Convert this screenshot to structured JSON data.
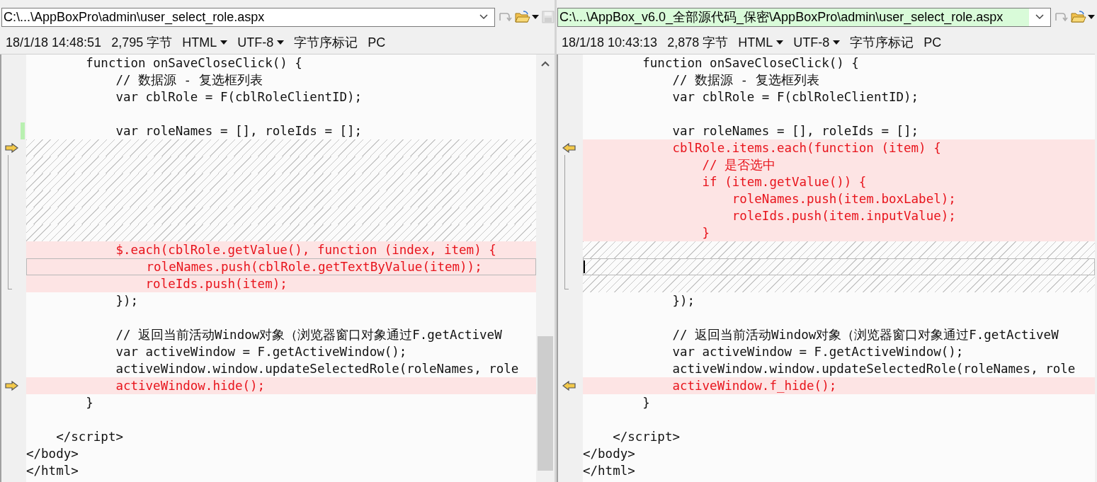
{
  "panes": [
    {
      "path": "C:\\...\\AppBoxPro\\admin\\user_select_role.aspx",
      "path_highlighted": false,
      "save_enabled": false,
      "info": {
        "timestamp": "18/1/18 14:48:51",
        "size": "2,795 字节",
        "format": "HTML",
        "encoding": "UTF-8",
        "bom": "字节序标记",
        "line_ending": "PC"
      },
      "lines": [
        {
          "kind": "code",
          "text": "        function onSaveCloseClick() {"
        },
        {
          "kind": "code",
          "text": "            // 数据源 - 复选框列表"
        },
        {
          "kind": "code",
          "text": "            var cblRole = F(cblRoleClientID);"
        },
        {
          "kind": "blank"
        },
        {
          "kind": "code",
          "text": "            var roleNames = [], roleIds = [];",
          "edited": true
        },
        {
          "kind": "filler",
          "arrow": true
        },
        {
          "kind": "filler"
        },
        {
          "kind": "filler"
        },
        {
          "kind": "filler"
        },
        {
          "kind": "filler"
        },
        {
          "kind": "filler"
        },
        {
          "kind": "code",
          "text": "            $.each(cblRole.getValue(), function (index, item) {",
          "changed": true
        },
        {
          "kind": "code",
          "text": "                roleNames.push(cblRole.getTextByValue(item));",
          "changed": true,
          "current": true
        },
        {
          "kind": "code",
          "text": "                roleIds.push(item);",
          "changed": true
        },
        {
          "kind": "code",
          "text": "            });"
        },
        {
          "kind": "blank"
        },
        {
          "kind": "code",
          "text": "            // 返回当前活动Window对象（浏览器窗口对象通过F.getActiveW"
        },
        {
          "kind": "code",
          "text": "            var activeWindow = F.getActiveWindow();"
        },
        {
          "kind": "code",
          "text": "            activeWindow.window.updateSelectedRole(roleNames, role"
        },
        {
          "kind": "code",
          "text": "            activeWindow.hide();",
          "changed": true,
          "arrow": true
        },
        {
          "kind": "code",
          "text": "        }"
        },
        {
          "kind": "blank"
        },
        {
          "kind": "code",
          "text": "    </script>"
        },
        {
          "kind": "code",
          "text": "</body>"
        },
        {
          "kind": "code",
          "text": "</html>"
        }
      ]
    },
    {
      "path": "C:\\...\\AppBox_v6.0_全部源代码_保密\\AppBoxPro\\admin\\user_select_role.aspx",
      "path_highlighted": true,
      "info": {
        "timestamp": "18/1/18 10:43:13",
        "size": "2,878 字节",
        "format": "HTML",
        "encoding": "UTF-8",
        "bom": "字节序标记",
        "line_ending": "PC"
      },
      "lines": [
        {
          "kind": "code",
          "text": "        function onSaveCloseClick() {"
        },
        {
          "kind": "code",
          "text": "            // 数据源 - 复选框列表"
        },
        {
          "kind": "code",
          "text": "            var cblRole = F(cblRoleClientID);"
        },
        {
          "kind": "blank"
        },
        {
          "kind": "code",
          "text": "            var roleNames = [], roleIds = [];"
        },
        {
          "kind": "code",
          "text": "            cblRole.items.each(function (item) {",
          "changed": true,
          "arrow": true
        },
        {
          "kind": "code",
          "text": "                // 是否选中",
          "changed": true
        },
        {
          "kind": "code",
          "text": "                if (item.getValue()) {",
          "changed": true
        },
        {
          "kind": "code",
          "text": "                    roleNames.push(item.boxLabel);",
          "changed": true
        },
        {
          "kind": "code",
          "text": "                    roleIds.push(item.inputValue);",
          "changed": true
        },
        {
          "kind": "code",
          "text": "                }",
          "changed": true
        },
        {
          "kind": "filler"
        },
        {
          "kind": "filler",
          "current": true,
          "cursor": true
        },
        {
          "kind": "filler"
        },
        {
          "kind": "code",
          "text": "            });"
        },
        {
          "kind": "blank"
        },
        {
          "kind": "code",
          "text": "            // 返回当前活动Window对象（浏览器窗口对象通过F.getActiveW"
        },
        {
          "kind": "code",
          "text": "            var activeWindow = F.getActiveWindow();"
        },
        {
          "kind": "code",
          "text": "            activeWindow.window.updateSelectedRole(roleNames, role"
        },
        {
          "kind": "code",
          "text": "            activeWindow.f_hide();",
          "changed": true,
          "arrow": true
        },
        {
          "kind": "code",
          "text": "        }"
        },
        {
          "kind": "blank"
        },
        {
          "kind": "code",
          "text": "    </script>"
        },
        {
          "kind": "code",
          "text": "</body>"
        },
        {
          "kind": "code",
          "text": "</html>"
        }
      ]
    }
  ]
}
